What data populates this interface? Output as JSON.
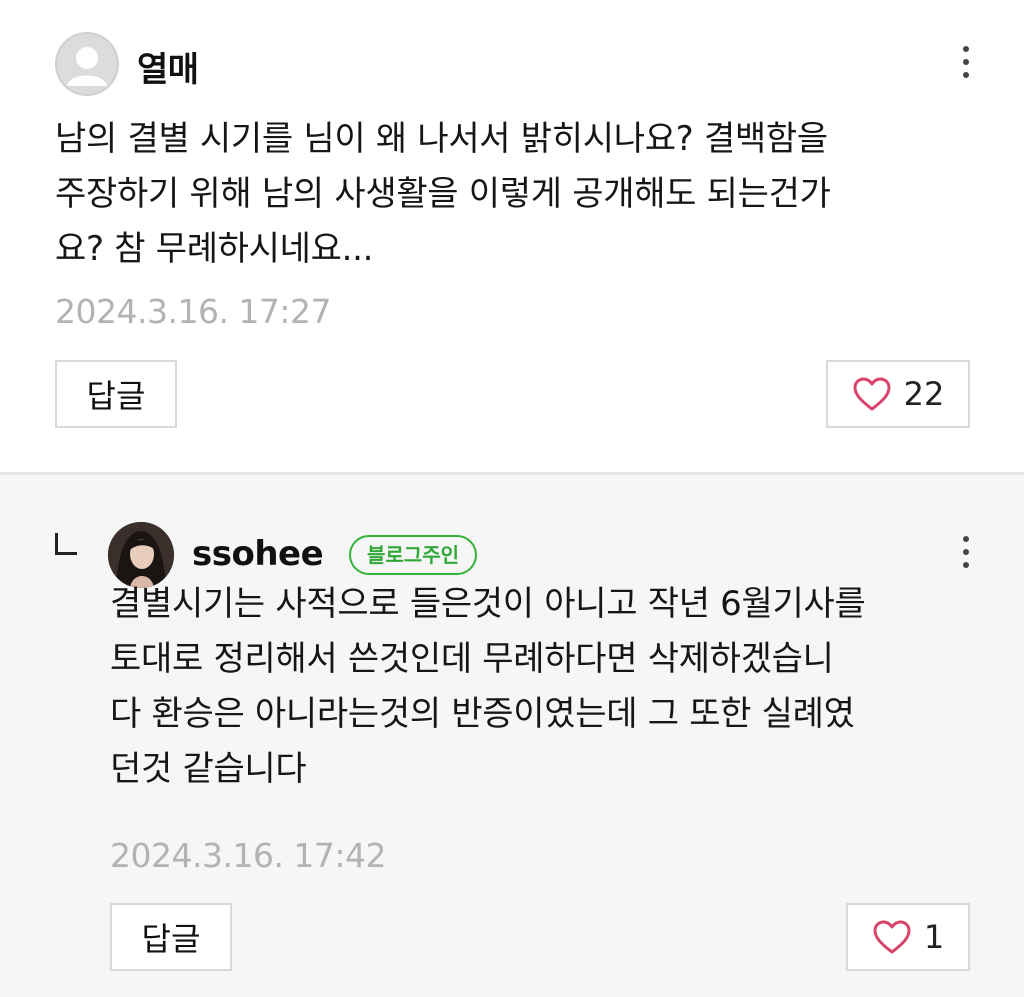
{
  "comments": [
    {
      "author": "열매",
      "body_lines": [
        "남의 결별 시기를 님이 왜 나서서 밝히시나요? 결백함을",
        "주장하기 위해 남의 사생활을 이렇게 공개해도 되는건가",
        "요? 참 무례하시네요..."
      ],
      "timestamp": "2024.3.16. 17:27",
      "reply_label": "답글",
      "like_count": "22"
    },
    {
      "author": "ssohee",
      "badge": "블로그주인",
      "body_lines": [
        "결별시기는 사적으로 들은것이 아니고 작년 6월기사를",
        "토대로 정리해서 쓴것인데 무례하다면 삭제하겠습니",
        "다 환승은 아니라는것의 반증이였는데 그 또한 실례였",
        "던것 같습니다"
      ],
      "timestamp": "2024.3.16. 17:42",
      "reply_label": "답글",
      "like_count": "1"
    }
  ],
  "colors": {
    "badge_green": "#33b23c",
    "heart_pink": "#d9446a",
    "timestamp_gray": "#b3b3b3",
    "reply_bg": "#f6f6f6"
  },
  "icons": {
    "more": "vertical-ellipsis-icon",
    "like": "heart-outline-icon",
    "reply_marker": "reply-corner-icon",
    "default_avatar": "user-silhouette-icon"
  }
}
